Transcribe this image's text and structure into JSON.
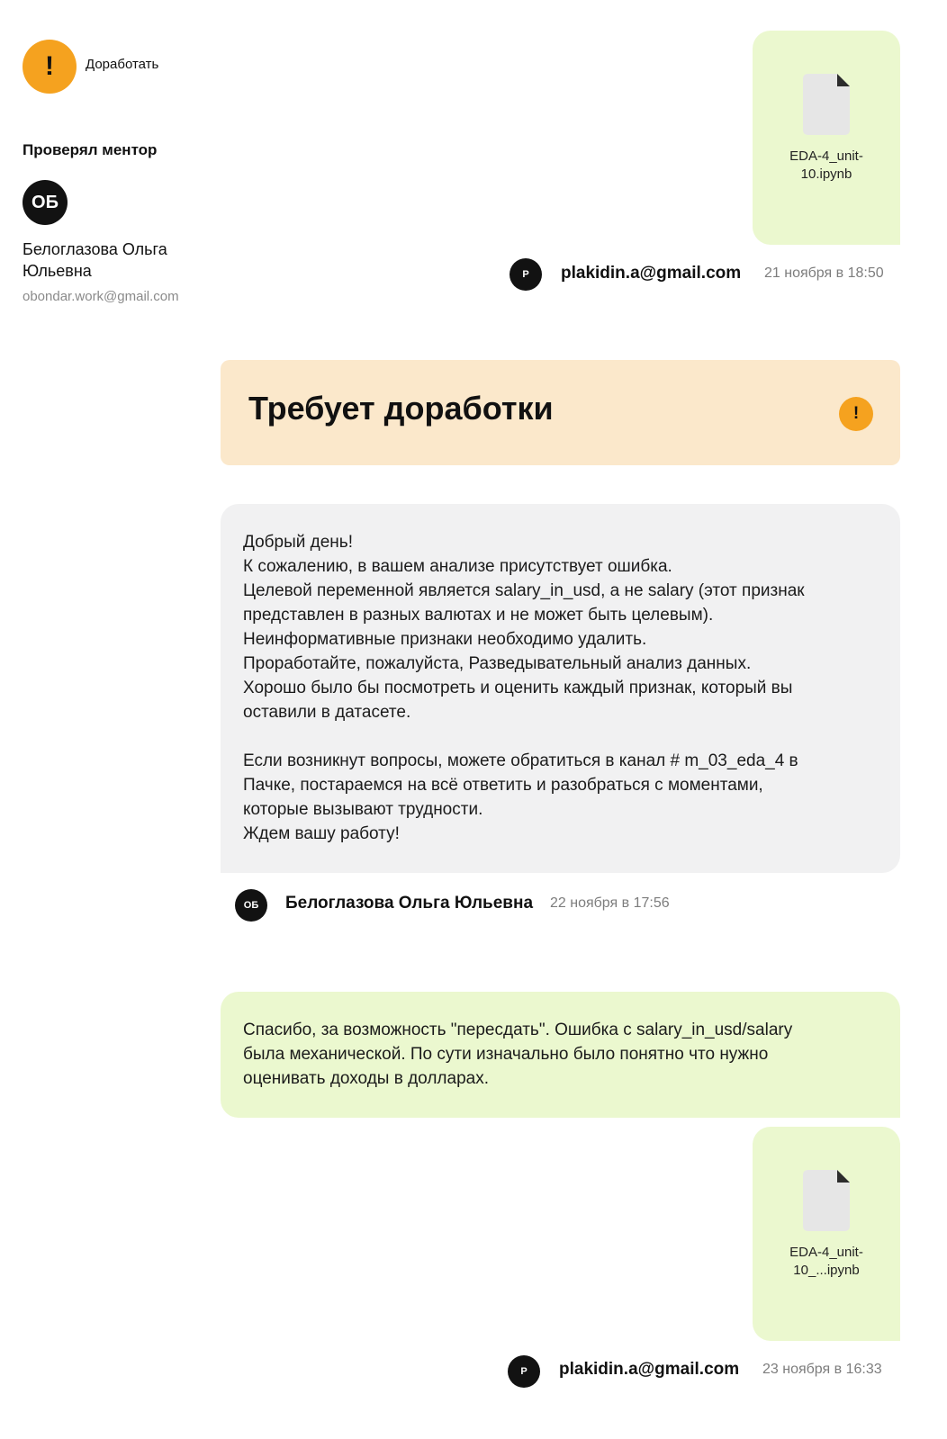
{
  "sidebar": {
    "status_icon": "exclamation-icon",
    "status_glyph": "!",
    "status_label": "Доработать",
    "mentor_heading": "Проверял ментор",
    "mentor": {
      "initials": "ОБ",
      "name": "Белоглазова Ольга Юльевна",
      "email": "obondar.work@gmail.com"
    }
  },
  "thread": {
    "submission_1": {
      "file_icon": "file-icon",
      "file_name": "EDA-4_unit-10.ipynb",
      "author_initial": "P",
      "author": "plakidin.a@gmail.com",
      "time": "21 ноября в 18:50"
    },
    "status_banner": {
      "title": "Требует доработки",
      "icon": "exclamation-icon",
      "glyph": "!"
    },
    "review": {
      "lines": [
        "Добрый день!",
        "К сожалению, в вашем анализе присутствует ошибка.",
        "Целевой переменной является salary_in_usd, а не salary (этот признак",
        "представлен в разных валютах и не может быть целевым).",
        "Неинформативные признаки необходимо удалить.",
        "Проработайте, пожалуйста, Разведывательный анализ данных.",
        "Хорошо было бы посмотреть и оценить каждый признак, который вы",
        "оставили в датасете.",
        "",
        "Если возникнут вопросы, можете обратиться в канал # m_03_eda_4 в",
        "Пачке, постараемся на всё ответить и разобраться с моментами,",
        "которые вызывают трудности.",
        "Ждем вашу работу!"
      ],
      "author_initials": "ОБ",
      "author": "Белоглазова Ольга Юльевна",
      "time": "22 ноября в 17:56"
    },
    "reply": {
      "lines": [
        "Спасибо, за возможность \"пересдать\". Ошибка с salary_in_usd/salary",
        "была механической. По сути изначально было понятно что нужно",
        "оценивать доходы в долларах."
      ]
    },
    "submission_2": {
      "file_icon": "file-icon",
      "file_name": "EDA-4_unit-10_...ipynb",
      "author_initial": "P",
      "author": "plakidin.a@gmail.com",
      "time": "23 ноября в 16:33"
    }
  },
  "colors": {
    "accent_orange": "#f5a21f",
    "student_bubble": "#ebf8cf",
    "mentor_bubble": "#f1f1f2",
    "banner": "#fbe8cb"
  }
}
